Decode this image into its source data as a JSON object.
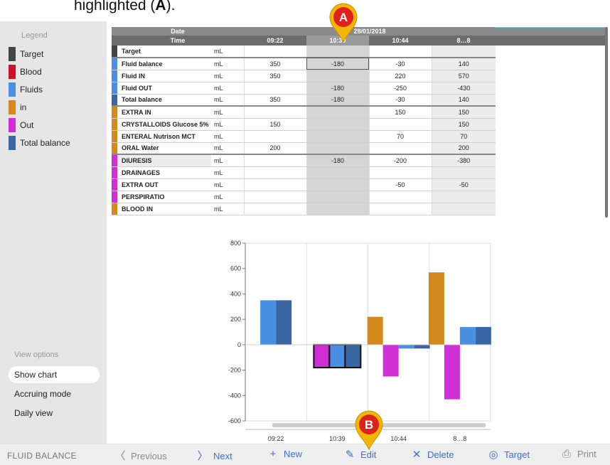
{
  "caption": {
    "text": "highlighted (",
    "bold": "A",
    "tail": ")."
  },
  "legend": {
    "title": "Legend",
    "items": [
      {
        "label": "Target",
        "color": "#444444"
      },
      {
        "label": "Blood",
        "color": "#d0102b"
      },
      {
        "label": "Fluids",
        "color": "#4a90e2"
      },
      {
        "label": "in",
        "color": "#d4891c"
      },
      {
        "label": "Out",
        "color": "#d12fd6"
      },
      {
        "label": "Total balance",
        "color": "#3a67a3"
      }
    ]
  },
  "view_options": {
    "title": "View options",
    "items": [
      "Show chart",
      "Accruing mode",
      "Daily view"
    ],
    "active": "Show chart"
  },
  "table": {
    "date_label": "Date",
    "date_value": "28/01/2018",
    "time_label": "Time",
    "times": [
      "09:22",
      "10:39",
      "10:44",
      "8…8"
    ],
    "rows": [
      {
        "name": "Target",
        "unit": "mL",
        "color": "#444444",
        "values": [
          "",
          "",
          "",
          ""
        ]
      },
      {
        "name": "Fluid balance",
        "unit": "mL",
        "color": "#4a90e2",
        "values": [
          "350",
          "-180",
          "-30",
          "140"
        ]
      },
      {
        "name": "Fluid IN",
        "unit": "mL",
        "color": "#4a90e2",
        "values": [
          "350",
          "",
          "220",
          "570"
        ]
      },
      {
        "name": "Fluid OUT",
        "unit": "mL",
        "color": "#4a90e2",
        "values": [
          "",
          "-180",
          "-250",
          "-430"
        ]
      },
      {
        "name": "Total balance",
        "unit": "mL",
        "color": "#3a67a3",
        "values": [
          "350",
          "-180",
          "-30",
          "140"
        ]
      },
      {
        "name": "EXTRA IN",
        "unit": "mL",
        "color": "#d4891c",
        "values": [
          "",
          "",
          "150",
          "150"
        ]
      },
      {
        "name": "CRYSTALLOIDS Glucose 5%",
        "unit": "mL",
        "color": "#d4891c",
        "values": [
          "150",
          "",
          "",
          "150"
        ]
      },
      {
        "name": "ENTERAL Nutrison MCT",
        "unit": "mL",
        "color": "#d4891c",
        "values": [
          "",
          "",
          "70",
          "70"
        ]
      },
      {
        "name": "ORAL Water",
        "unit": "mL",
        "color": "#d4891c",
        "values": [
          "200",
          "",
          "",
          "200"
        ]
      },
      {
        "name": "DIURESIS",
        "unit": "mL",
        "color": "#d12fd6",
        "values": [
          "",
          "-180",
          "-200",
          "-380"
        ]
      },
      {
        "name": "DRAINAGES",
        "unit": "mL",
        "color": "#d12fd6",
        "values": [
          "",
          "",
          "",
          ""
        ]
      },
      {
        "name": "EXTRA OUT",
        "unit": "mL",
        "color": "#d12fd6",
        "values": [
          "",
          "",
          "-50",
          "-50"
        ]
      },
      {
        "name": "PERSPIRATIO",
        "unit": "mL",
        "color": "#d12fd6",
        "values": [
          "",
          "",
          "",
          ""
        ]
      },
      {
        "name": "BLOOD IN",
        "unit": "mL",
        "color": "#d4891c",
        "values": [
          "",
          "",
          "",
          ""
        ]
      }
    ]
  },
  "chart_data": {
    "type": "bar",
    "categories": [
      "09:22",
      "10:39",
      "10:44",
      "8…8"
    ],
    "ylim": [
      -600,
      800
    ],
    "yticks": [
      800,
      600,
      400,
      200,
      0,
      -200,
      -400,
      -600
    ],
    "series": [
      {
        "color": "#d4891c",
        "values": [
          0,
          0,
          220,
          570
        ]
      },
      {
        "color": "#d12fd6",
        "values": [
          0,
          -180,
          -250,
          -430
        ]
      },
      {
        "color": "#4a90e2",
        "values": [
          350,
          -180,
          -30,
          140
        ]
      },
      {
        "color": "#3a67a3",
        "values": [
          350,
          -180,
          -30,
          140
        ]
      }
    ],
    "grid": true
  },
  "bottom_bar": {
    "title": "FLUID BALANCE",
    "buttons": [
      {
        "label": "Previous",
        "icon": "chevron-left-icon",
        "glyph": "〈"
      },
      {
        "label": "Next",
        "icon": "chevron-right-icon",
        "glyph": "〉"
      },
      {
        "label": "New",
        "icon": "plus-icon",
        "glyph": "+"
      },
      {
        "label": "Edit",
        "icon": "pencil-icon",
        "glyph": "✎"
      },
      {
        "label": "Delete",
        "icon": "close-icon",
        "glyph": "✕"
      },
      {
        "label": "Target",
        "icon": "target-icon",
        "glyph": "◎"
      },
      {
        "label": "Print",
        "icon": "printer-icon",
        "glyph": "⎙"
      }
    ]
  },
  "markers": [
    {
      "letter": "A",
      "color": "#f2b705"
    },
    {
      "letter": "B",
      "color": "#f2b705"
    }
  ]
}
